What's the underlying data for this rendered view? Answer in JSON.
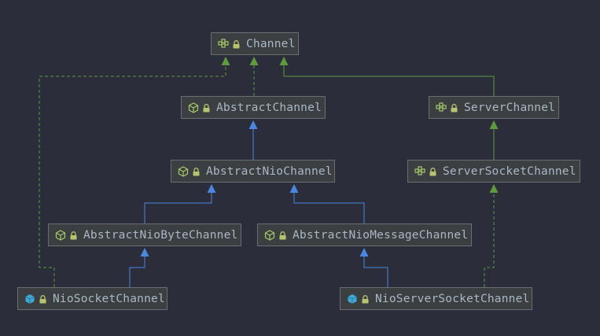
{
  "colors": {
    "background": "#2b2d3a",
    "node_fill": "#3c3f41",
    "node_border": "#6b6e70",
    "text": "#a9b7c6",
    "extends_edge": "#4a88e0",
    "implements_edge": "#5f9a3e",
    "interface_icon": "#a6c96a",
    "abstract_icon": "#a6c96a",
    "class_icon": "#3fa9d6",
    "lock_icon": "#b7c36f"
  },
  "nodes": [
    {
      "id": "channel",
      "label": "Channel",
      "kind": "interface-icon"
    },
    {
      "id": "abstract-channel",
      "label": "AbstractChannel",
      "kind": "abstract-class-icon"
    },
    {
      "id": "server-channel",
      "label": "ServerChannel",
      "kind": "interface-icon"
    },
    {
      "id": "abstract-nio-channel",
      "label": "AbstractNioChannel",
      "kind": "abstract-class-icon"
    },
    {
      "id": "server-socket-channel",
      "label": "ServerSocketChannel",
      "kind": "interface-icon"
    },
    {
      "id": "abstract-nio-byte-channel",
      "label": "AbstractNioByteChannel",
      "kind": "abstract-class-icon"
    },
    {
      "id": "abstract-nio-message-channel",
      "label": "AbstractNioMessageChannel",
      "kind": "abstract-class-icon"
    },
    {
      "id": "nio-socket-channel",
      "label": "NioSocketChannel",
      "kind": "class-icon"
    },
    {
      "id": "nio-server-socket-channel",
      "label": "NioServerSocketChannel",
      "kind": "class-icon"
    }
  ],
  "edges": [
    {
      "from": "abstract-channel",
      "to": "channel",
      "type": "implements"
    },
    {
      "from": "server-channel",
      "to": "channel",
      "type": "extends-interface"
    },
    {
      "from": "nio-socket-channel",
      "to": "channel",
      "type": "implements"
    },
    {
      "from": "abstract-nio-channel",
      "to": "abstract-channel",
      "type": "extends"
    },
    {
      "from": "server-socket-channel",
      "to": "server-channel",
      "type": "extends-interface"
    },
    {
      "from": "abstract-nio-byte-channel",
      "to": "abstract-nio-channel",
      "type": "extends"
    },
    {
      "from": "abstract-nio-message-channel",
      "to": "abstract-nio-channel",
      "type": "extends"
    },
    {
      "from": "nio-socket-channel",
      "to": "abstract-nio-byte-channel",
      "type": "extends"
    },
    {
      "from": "nio-server-socket-channel",
      "to": "abstract-nio-message-channel",
      "type": "extends"
    },
    {
      "from": "nio-server-socket-channel",
      "to": "server-socket-channel",
      "type": "implements"
    }
  ]
}
